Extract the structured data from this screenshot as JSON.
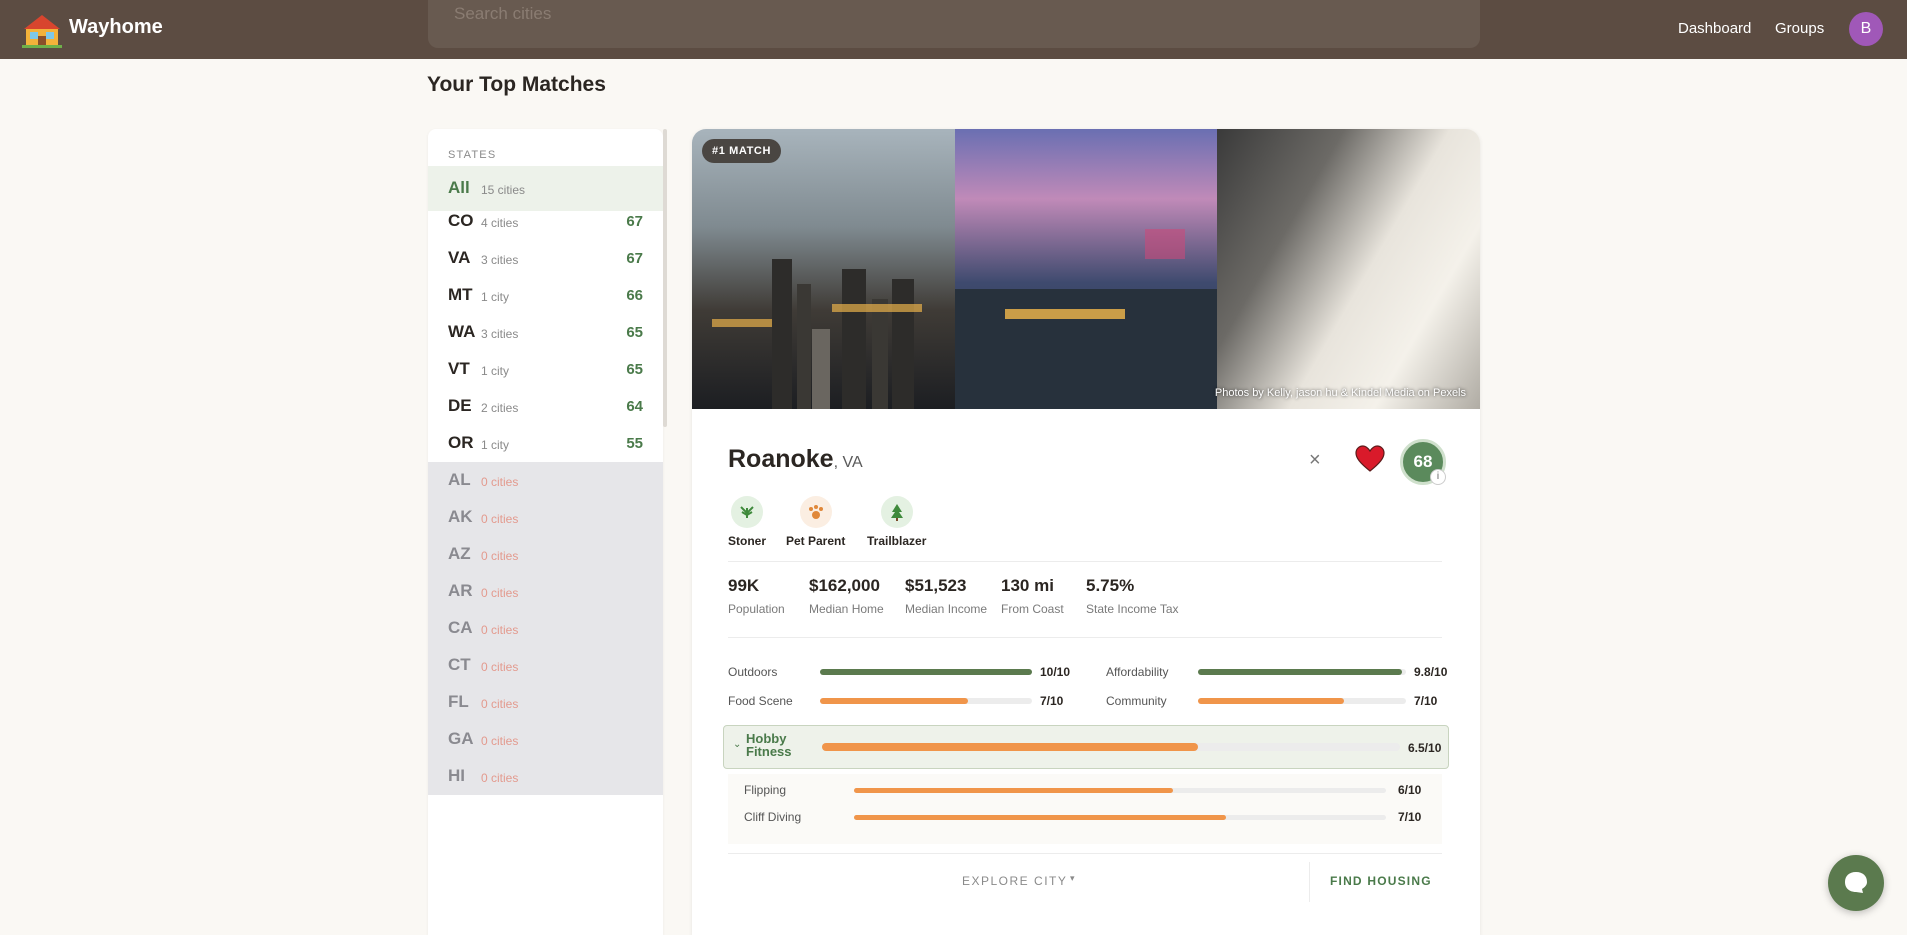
{
  "header": {
    "brand": "Wayhome",
    "search_placeholder": "Search cities",
    "nav": {
      "dashboard": "Dashboard",
      "groups": "Groups"
    },
    "avatar_initial": "B"
  },
  "page_title": "Your Top Matches",
  "states_panel": {
    "heading": "STATES",
    "rows": [
      {
        "code": "All",
        "count": "15 cities",
        "score": ""
      },
      {
        "code": "CO",
        "count": "4 cities",
        "score": "67"
      },
      {
        "code": "VA",
        "count": "3 cities",
        "score": "67"
      },
      {
        "code": "MT",
        "count": "1 city",
        "score": "66"
      },
      {
        "code": "WA",
        "count": "3 cities",
        "score": "65"
      },
      {
        "code": "VT",
        "count": "1 city",
        "score": "65"
      },
      {
        "code": "DE",
        "count": "2 cities",
        "score": "64"
      },
      {
        "code": "OR",
        "count": "1 city",
        "score": "55"
      },
      {
        "code": "AL",
        "count": "0 cities",
        "score": ""
      },
      {
        "code": "AK",
        "count": "0 cities",
        "score": ""
      },
      {
        "code": "AZ",
        "count": "0 cities",
        "score": ""
      },
      {
        "code": "AR",
        "count": "0 cities",
        "score": ""
      },
      {
        "code": "CA",
        "count": "0 cities",
        "score": ""
      },
      {
        "code": "CT",
        "count": "0 cities",
        "score": ""
      },
      {
        "code": "FL",
        "count": "0 cities",
        "score": ""
      },
      {
        "code": "GA",
        "count": "0 cities",
        "score": ""
      },
      {
        "code": "HI",
        "count": "0 cities",
        "score": ""
      }
    ]
  },
  "card": {
    "badge": "#1 MATCH",
    "photo_credit": "Photos by Kelly, jason hu & Kindel Media on Pexels",
    "city": "Roanoke",
    "state": ", VA",
    "score": "68",
    "info": "i",
    "close": "×",
    "tags": [
      {
        "label": "Stoner",
        "icon": "leaf-icon",
        "color": "#e4f1e2"
      },
      {
        "label": "Pet Parent",
        "icon": "paw-icon",
        "color": "#fbeee2"
      },
      {
        "label": "Trailblazer",
        "icon": "tree-icon",
        "color": "#e4f1e2"
      }
    ],
    "stats": [
      {
        "value": "99K",
        "label": "Population"
      },
      {
        "value": "$162,000",
        "label": "Median Home"
      },
      {
        "value": "$51,523",
        "label": "Median Income"
      },
      {
        "value": "130 mi",
        "label": "From Coast"
      },
      {
        "value": "5.75%",
        "label": "State Income Tax"
      }
    ],
    "metrics": [
      {
        "label": "Outdoors",
        "value": "10/10",
        "score": 10
      },
      {
        "label": "Affordability",
        "value": "9.8/10",
        "score": 9.8
      },
      {
        "label": "Food Scene",
        "value": "7/10",
        "score": 7
      },
      {
        "label": "Community",
        "value": "7/10",
        "score": 7
      }
    ],
    "hobby": {
      "title": "Hobby Fitness",
      "value": "6.5/10",
      "score": 6.5,
      "chevron": "⌄"
    },
    "hobbies": [
      {
        "label": "Flipping",
        "value": "6/10",
        "score": 6
      },
      {
        "label": "Cliff Diving",
        "value": "7/10",
        "score": 7
      }
    ],
    "explore": "EXPLORE CITY",
    "explore_caret": "▾",
    "find_housing": "FIND HOUSING"
  },
  "colors": {
    "header": "#5c4c42",
    "accent_green": "#5b7a4e",
    "accent_orange": "#f0954a",
    "avatar": "#a058b8"
  }
}
